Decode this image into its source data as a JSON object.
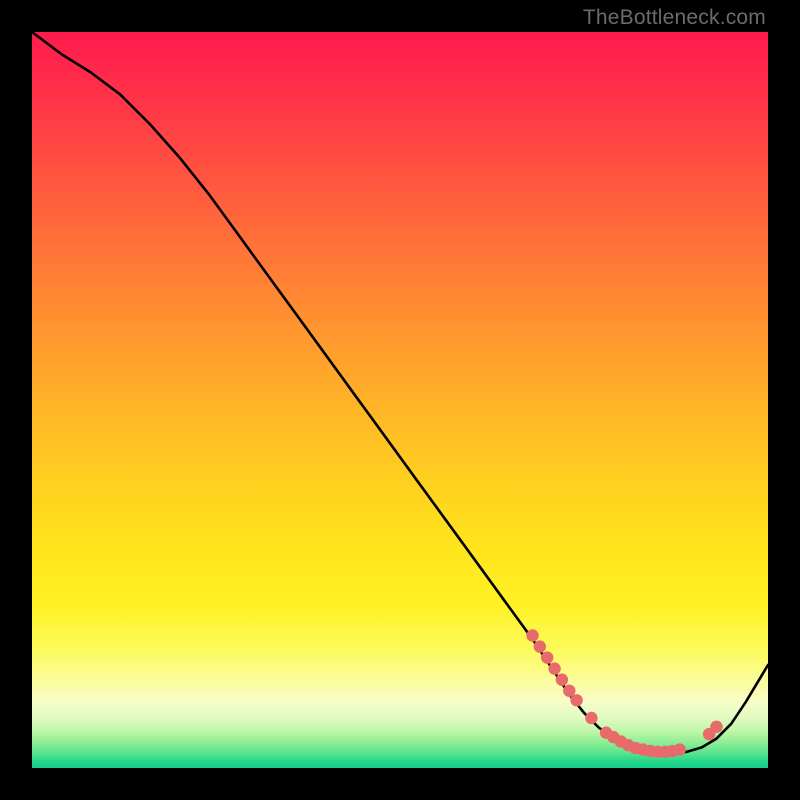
{
  "watermark": "TheBottleneck.com",
  "colors": {
    "line": "#000000",
    "dot_fill": "#e86a6a",
    "dot_stroke": "#c94f4f"
  },
  "chart_data": {
    "type": "line",
    "title": "",
    "xlabel": "",
    "ylabel": "",
    "xlim": [
      0,
      100
    ],
    "ylim": [
      0,
      100
    ],
    "grid": false,
    "series": [
      {
        "name": "curve",
        "x": [
          0,
          4,
          8,
          12,
          16,
          20,
          24,
          28,
          32,
          36,
          40,
          44,
          48,
          52,
          56,
          60,
          64,
          68,
          71,
          73,
          75,
          77,
          79,
          81,
          83,
          85,
          87,
          89,
          91,
          93,
          95,
          97,
          100
        ],
        "y": [
          100,
          97,
          94.5,
          91.5,
          87.5,
          83,
          78,
          72.5,
          67,
          61.5,
          56,
          50.5,
          45,
          39.5,
          34,
          28.5,
          23,
          17.5,
          13,
          10,
          7.5,
          5.5,
          4,
          3,
          2.3,
          2,
          2,
          2.2,
          2.8,
          4,
          6,
          9,
          14
        ]
      }
    ],
    "dots": {
      "name": "cluster",
      "x": [
        68,
        69,
        70,
        71,
        72,
        73,
        74,
        76,
        78,
        79,
        80,
        81,
        82,
        83,
        84,
        85,
        86,
        87,
        88,
        92,
        93
      ],
      "y": [
        18,
        16.5,
        15,
        13.5,
        12,
        10.5,
        9.2,
        6.8,
        4.8,
        4.2,
        3.6,
        3.1,
        2.7,
        2.5,
        2.3,
        2.2,
        2.2,
        2.3,
        2.5,
        4.6,
        5.6
      ]
    }
  }
}
